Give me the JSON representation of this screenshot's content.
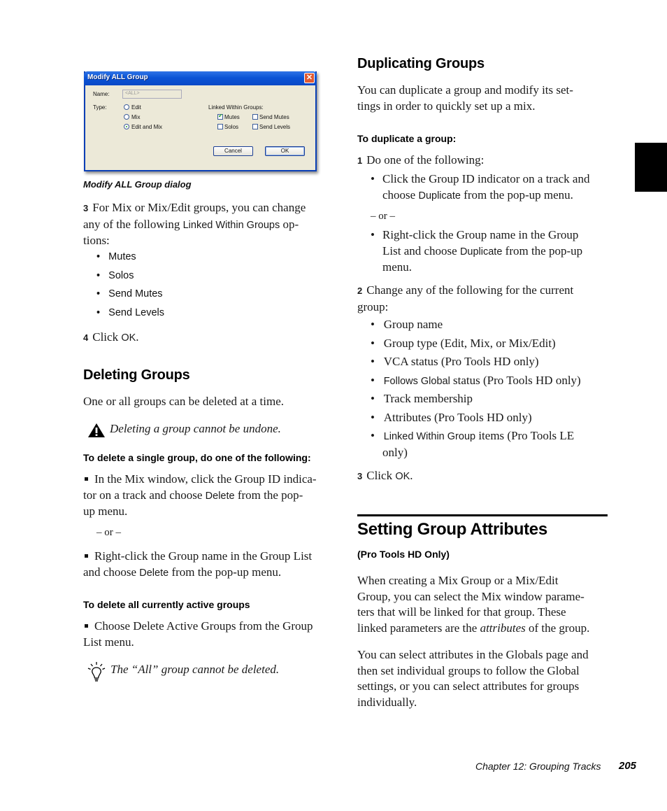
{
  "dialog": {
    "title": "Modify ALL Group",
    "close_glyph": "✕",
    "name_label": "Name:",
    "name_value": "<ALL>",
    "type_label": "Type:",
    "type_options": [
      {
        "label": "Edit",
        "selected": false
      },
      {
        "label": "Mix",
        "selected": false
      },
      {
        "label": "Edit and Mix",
        "selected": true
      }
    ],
    "linked_label": "Linked Within Groups:",
    "linked_options": [
      {
        "label": "Mutes",
        "checked": true
      },
      {
        "label": "Solos",
        "checked": false
      },
      {
        "label": "Send Mutes",
        "checked": false
      },
      {
        "label": "Send Levels",
        "checked": false
      }
    ],
    "cancel_label": "Cancel",
    "ok_label": "OK"
  },
  "left": {
    "caption": "Modify ALL Group dialog",
    "step3": {
      "num": "3",
      "line1": "For Mix or Mix/Edit groups, you can change",
      "line2a": "any of the following ",
      "line2b": "Linked Within Groups",
      "line2c": " op-",
      "line3": "tions:"
    },
    "linked_items": [
      "Mutes",
      "Solos",
      "Send Mutes",
      "Send Levels"
    ],
    "step4": {
      "num": "4",
      "a": "Click ",
      "b": "OK",
      "c": "."
    },
    "deleting": {
      "heading": "Deleting Groups",
      "intro": "One or all groups can be deleted at a time.",
      "warning": "Deleting a group cannot be undone.",
      "proc1": "To delete a single group, do one of the following:",
      "opt1_l1": "In the Mix window, click the Group ID indica-",
      "opt1_l2a": "tor on a track and choose ",
      "opt1_l2b": "Delete",
      "opt1_l2c": " from the pop-",
      "opt1_l3": "up menu.",
      "or": "– or –",
      "opt2_l1": "Right-click the Group name in the Group List",
      "opt2_l2a": "and choose ",
      "opt2_l2b": "Delete",
      "opt2_l2c": " from the pop-up menu.",
      "proc2": "To delete all currently active groups",
      "opt3_l1": "Choose Delete Active Groups from the Group",
      "opt3_l2": "List menu.",
      "tip": "The “All” group cannot be deleted."
    }
  },
  "right": {
    "duplicating": {
      "heading": "Duplicating Groups",
      "intro_l1": "You can duplicate a group and modify its set-",
      "intro_l2": "tings in order to quickly set up a mix.",
      "proc": "To duplicate a group:",
      "step1": {
        "num": "1",
        "text": "Do one of the following:"
      },
      "b1_l1": "Click the Group ID indicator on a track and",
      "b1_l2a": "choose ",
      "b1_l2b": "Duplicate",
      "b1_l2c": " from the pop-up menu.",
      "or": "– or –",
      "b2_l1": "Right-click the Group name in the Group",
      "b2_l2a": "List and choose ",
      "b2_l2b": "Duplicate",
      "b2_l2c": " from the pop-up",
      "b2_l3": "menu.",
      "step2": {
        "num": "2",
        "l1": "Change any of the following for the current",
        "l2": "group:"
      },
      "items": [
        "Group name",
        "Group type (Edit, Mix, or Mix/Edit)",
        "VCA status (Pro Tools HD only)"
      ],
      "item4a": "Follows Global",
      "item4b": " status (Pro Tools HD only)",
      "item5": "Track membership",
      "item6": "Attributes (Pro Tools HD only)",
      "item7a": "Linked Within Group",
      "item7b": " items (Pro Tools LE",
      "item7c": "only)",
      "step3": {
        "num": "3",
        "a": "Click ",
        "b": "OK",
        "c": "."
      }
    },
    "attributes": {
      "heading": "Setting Group Attributes",
      "subheading": "(Pro Tools HD Only)",
      "p1_l1": "When creating a Mix Group or a Mix/Edit",
      "p1_l2": "Group, you can select the Mix window parame-",
      "p1_l3": "ters that will be linked for that group. These",
      "p1_l4a": "linked parameters are the ",
      "p1_l4b": "attributes",
      "p1_l4c": " of the group.",
      "p2_l1": "You can select attributes in the Globals page and",
      "p2_l2": "then set individual groups to follow the Global",
      "p2_l3": "settings, or you can select attributes for groups",
      "p2_l4": "individually."
    }
  },
  "footer": {
    "chapter": "Chapter 12: Grouping Tracks",
    "page": "205"
  }
}
